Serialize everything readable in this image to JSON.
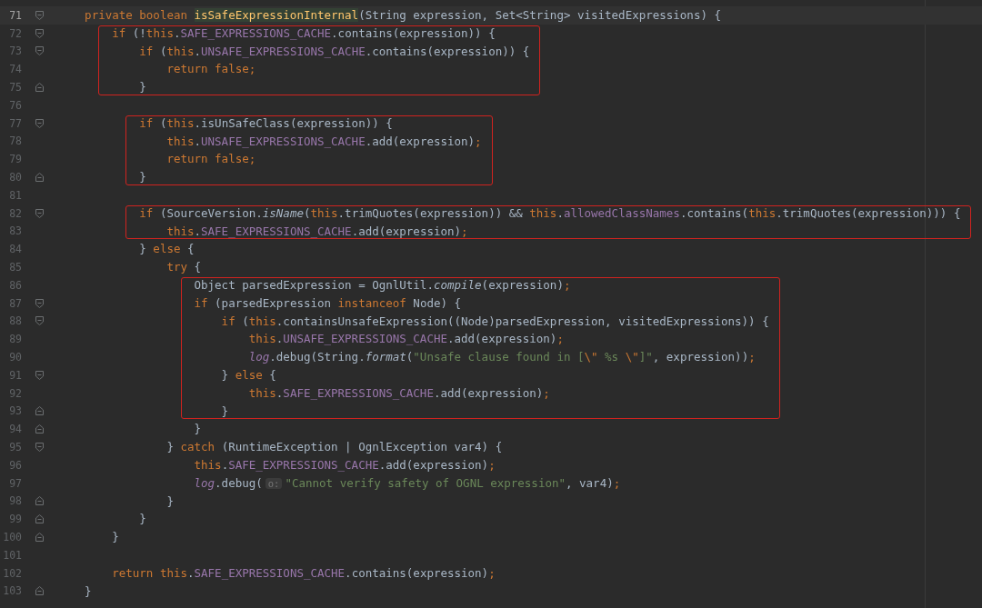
{
  "editor": {
    "blocks": [
      {
        "annotated": false,
        "lines": [
          {
            "number": "71",
            "current": true,
            "fold_start": true,
            "fold_end": false,
            "tokens": [
              {
                "kind": "kw",
                "text": "    private boolean "
              },
              {
                "kind": "decl",
                "text": "isSafeExpressionInternal"
              },
              {
                "kind": "plain",
                "text": "(String expression, Set<String> visitedExpressions) {"
              }
            ]
          }
        ]
      },
      {
        "annotated": true,
        "lines": [
          {
            "number": "72",
            "current": false,
            "fold_start": true,
            "fold_end": false,
            "tokens": [
              {
                "kind": "kw",
                "text": "        if "
              },
              {
                "kind": "plain",
                "text": "(!"
              },
              {
                "kind": "kw",
                "text": "this"
              },
              {
                "kind": "plain",
                "text": "."
              },
              {
                "kind": "field",
                "text": "SAFE_EXPRESSIONS_CACHE"
              },
              {
                "kind": "plain",
                "text": ".contains(expression)) {"
              }
            ]
          },
          {
            "number": "73",
            "current": false,
            "fold_start": true,
            "fold_end": false,
            "tokens": [
              {
                "kind": "kw",
                "text": "            if "
              },
              {
                "kind": "plain",
                "text": "("
              },
              {
                "kind": "kw",
                "text": "this"
              },
              {
                "kind": "plain",
                "text": "."
              },
              {
                "kind": "field",
                "text": "UNSAFE_EXPRESSIONS_CACHE"
              },
              {
                "kind": "plain",
                "text": ".contains(expression)) {"
              }
            ]
          },
          {
            "number": "74",
            "current": false,
            "fold_start": false,
            "fold_end": false,
            "tokens": [
              {
                "kind": "kw",
                "text": "                return false;"
              }
            ]
          },
          {
            "number": "75",
            "current": false,
            "fold_start": false,
            "fold_end": true,
            "tokens": [
              {
                "kind": "plain",
                "text": "            }"
              }
            ]
          }
        ]
      },
      {
        "annotated": false,
        "lines": [
          {
            "number": "76",
            "current": false,
            "fold_start": false,
            "fold_end": false
          }
        ]
      },
      {
        "annotated": true,
        "lines": [
          {
            "number": "77",
            "current": false,
            "fold_start": true,
            "fold_end": false,
            "tokens": [
              {
                "kind": "kw",
                "text": "            if "
              },
              {
                "kind": "plain",
                "text": "("
              },
              {
                "kind": "kw",
                "text": "this"
              },
              {
                "kind": "plain",
                "text": ".isUnSafeClass(expression)) {"
              }
            ]
          },
          {
            "number": "78",
            "current": false,
            "fold_start": false,
            "fold_end": false,
            "tokens": [
              {
                "kind": "kw",
                "text": "                this"
              },
              {
                "kind": "plain",
                "text": "."
              },
              {
                "kind": "field",
                "text": "UNSAFE_EXPRESSIONS_CACHE"
              },
              {
                "kind": "plain",
                "text": ".add(expression)"
              },
              {
                "kind": "kw",
                "text": ";"
              }
            ]
          },
          {
            "number": "79",
            "current": false,
            "fold_start": false,
            "fold_end": false,
            "tokens": [
              {
                "kind": "kw",
                "text": "                return false;"
              }
            ]
          },
          {
            "number": "80",
            "current": false,
            "fold_start": false,
            "fold_end": true,
            "tokens": [
              {
                "kind": "plain",
                "text": "            }"
              }
            ]
          }
        ]
      },
      {
        "annotated": false,
        "lines": [
          {
            "number": "81",
            "current": false,
            "fold_start": false,
            "fold_end": false
          }
        ]
      },
      {
        "annotated": true,
        "lines": [
          {
            "number": "82",
            "current": false,
            "fold_start": true,
            "fold_end": false,
            "tokens": [
              {
                "kind": "kw",
                "text": "            if "
              },
              {
                "kind": "plain",
                "text": "(SourceVersion."
              },
              {
                "kind": "smethod",
                "text": "isName"
              },
              {
                "kind": "plain",
                "text": "("
              },
              {
                "kind": "kw",
                "text": "this"
              },
              {
                "kind": "plain",
                "text": ".trimQuotes(expression)) && "
              },
              {
                "kind": "kw",
                "text": "this"
              },
              {
                "kind": "plain",
                "text": "."
              },
              {
                "kind": "field",
                "text": "allowedClassNames"
              },
              {
                "kind": "plain",
                "text": ".contains("
              },
              {
                "kind": "kw",
                "text": "this"
              },
              {
                "kind": "plain",
                "text": ".trimQuotes(expression))) {"
              }
            ]
          },
          {
            "number": "83",
            "current": false,
            "fold_start": false,
            "fold_end": false,
            "tokens": [
              {
                "kind": "kw",
                "text": "                this"
              },
              {
                "kind": "plain",
                "text": "."
              },
              {
                "kind": "field",
                "text": "SAFE_EXPRESSIONS_CACHE"
              },
              {
                "kind": "plain",
                "text": ".add(expression)"
              },
              {
                "kind": "kw",
                "text": ";"
              }
            ]
          }
        ]
      },
      {
        "annotated": false,
        "lines": [
          {
            "number": "84",
            "current": false,
            "fold_start": false,
            "fold_end": false,
            "tokens": [
              {
                "kind": "plain",
                "text": "            } "
              },
              {
                "kind": "kw",
                "text": "else "
              },
              {
                "kind": "plain",
                "text": "{"
              }
            ]
          },
          {
            "number": "85",
            "current": false,
            "fold_start": false,
            "fold_end": false,
            "tokens": [
              {
                "kind": "kw",
                "text": "                try "
              },
              {
                "kind": "plain",
                "text": "{"
              }
            ]
          }
        ]
      },
      {
        "annotated": true,
        "lines": [
          {
            "number": "86",
            "current": false,
            "fold_start": false,
            "fold_end": false,
            "tokens": [
              {
                "kind": "plain",
                "text": "                    Object parsedExpression = OgnlUtil."
              },
              {
                "kind": "smethod",
                "text": "compile"
              },
              {
                "kind": "plain",
                "text": "(expression)"
              },
              {
                "kind": "kw",
                "text": ";"
              }
            ]
          },
          {
            "number": "87",
            "current": false,
            "fold_start": true,
            "fold_end": false,
            "tokens": [
              {
                "kind": "kw",
                "text": "                    if "
              },
              {
                "kind": "plain",
                "text": "(parsedExpression "
              },
              {
                "kind": "kw",
                "text": "instanceof "
              },
              {
                "kind": "plain",
                "text": "Node) {"
              }
            ]
          },
          {
            "number": "88",
            "current": false,
            "fold_start": true,
            "fold_end": false,
            "tokens": [
              {
                "kind": "kw",
                "text": "                        if "
              },
              {
                "kind": "plain",
                "text": "("
              },
              {
                "kind": "kw",
                "text": "this"
              },
              {
                "kind": "plain",
                "text": ".containsUnsafeExpression((Node)parsedExpression, visitedExpressions)) {"
              }
            ]
          },
          {
            "number": "89",
            "current": false,
            "fold_start": false,
            "fold_end": false,
            "tokens": [
              {
                "kind": "kw",
                "text": "                            this"
              },
              {
                "kind": "plain",
                "text": "."
              },
              {
                "kind": "field",
                "text": "UNSAFE_EXPRESSIONS_CACHE"
              },
              {
                "kind": "plain",
                "text": ".add(expression)"
              },
              {
                "kind": "kw",
                "text": ";"
              }
            ]
          },
          {
            "number": "90",
            "current": false,
            "fold_start": false,
            "fold_end": false,
            "tokens": [
              {
                "kind": "sfield",
                "text": "                            log"
              },
              {
                "kind": "plain",
                "text": ".debug(String."
              },
              {
                "kind": "smethod",
                "text": "format"
              },
              {
                "kind": "plain",
                "text": "("
              },
              {
                "kind": "str",
                "text": "\"Unsafe clause found in ["
              },
              {
                "kind": "esc",
                "text": "\\\""
              },
              {
                "kind": "str",
                "text": " %s "
              },
              {
                "kind": "esc",
                "text": "\\\""
              },
              {
                "kind": "str",
                "text": "]\""
              },
              {
                "kind": "plain",
                "text": ", expression))"
              },
              {
                "kind": "kw",
                "text": ";"
              }
            ]
          },
          {
            "number": "91",
            "current": false,
            "fold_start": true,
            "fold_end": false,
            "tokens": [
              {
                "kind": "plain",
                "text": "                        } "
              },
              {
                "kind": "kw",
                "text": "else "
              },
              {
                "kind": "plain",
                "text": "{"
              }
            ]
          },
          {
            "number": "92",
            "current": false,
            "fold_start": false,
            "fold_end": false,
            "tokens": [
              {
                "kind": "kw",
                "text": "                            this"
              },
              {
                "kind": "plain",
                "text": "."
              },
              {
                "kind": "field",
                "text": "SAFE_EXPRESSIONS_CACHE"
              },
              {
                "kind": "plain",
                "text": ".add(expression)"
              },
              {
                "kind": "kw",
                "text": ";"
              }
            ]
          },
          {
            "number": "93",
            "current": false,
            "fold_start": false,
            "fold_end": true,
            "tokens": [
              {
                "kind": "plain",
                "text": "                        }"
              }
            ]
          }
        ]
      },
      {
        "annotated": false,
        "lines": [
          {
            "number": "94",
            "current": false,
            "fold_start": false,
            "fold_end": true,
            "tokens": [
              {
                "kind": "plain",
                "text": "                    }"
              }
            ]
          },
          {
            "number": "95",
            "current": false,
            "fold_start": true,
            "fold_end": false,
            "tokens": [
              {
                "kind": "plain",
                "text": "                } "
              },
              {
                "kind": "kw",
                "text": "catch "
              },
              {
                "kind": "plain",
                "text": "(RuntimeException | OgnlException var4) {"
              }
            ]
          },
          {
            "number": "96",
            "current": false,
            "fold_start": false,
            "fold_end": false,
            "tokens": [
              {
                "kind": "kw",
                "text": "                    this"
              },
              {
                "kind": "plain",
                "text": "."
              },
              {
                "kind": "field",
                "text": "SAFE_EXPRESSIONS_CACHE"
              },
              {
                "kind": "plain",
                "text": ".add(expression)"
              },
              {
                "kind": "kw",
                "text": ";"
              }
            ]
          },
          {
            "number": "97",
            "current": false,
            "fold_start": false,
            "fold_end": false,
            "tokens": [
              {
                "kind": "sfield",
                "text": "                    log"
              },
              {
                "kind": "plain",
                "text": ".debug("
              },
              {
                "kind": "hint",
                "text": "o:"
              },
              {
                "kind": "str",
                "text": "\"Cannot verify safety of OGNL expression\""
              },
              {
                "kind": "plain",
                "text": ", var4)"
              },
              {
                "kind": "kw",
                "text": ";"
              }
            ]
          },
          {
            "number": "98",
            "current": false,
            "fold_start": false,
            "fold_end": true,
            "tokens": [
              {
                "kind": "plain",
                "text": "                }"
              }
            ]
          },
          {
            "number": "99",
            "current": false,
            "fold_start": false,
            "fold_end": true,
            "tokens": [
              {
                "kind": "plain",
                "text": "            }"
              }
            ]
          },
          {
            "number": "100",
            "current": false,
            "fold_start": false,
            "fold_end": true,
            "tokens": [
              {
                "kind": "plain",
                "text": "        }"
              }
            ]
          },
          {
            "number": "101",
            "current": false,
            "fold_start": false,
            "fold_end": false
          },
          {
            "number": "102",
            "current": false,
            "fold_start": false,
            "fold_end": false,
            "tokens": [
              {
                "kind": "kw",
                "text": "        return this"
              },
              {
                "kind": "plain",
                "text": "."
              },
              {
                "kind": "field",
                "text": "SAFE_EXPRESSIONS_CACHE"
              },
              {
                "kind": "plain",
                "text": ".contains(expression)"
              },
              {
                "kind": "kw",
                "text": ";"
              }
            ]
          },
          {
            "number": "103",
            "current": false,
            "fold_start": false,
            "fold_end": true,
            "tokens": [
              {
                "kind": "plain",
                "text": "    }"
              }
            ]
          }
        ]
      }
    ]
  }
}
